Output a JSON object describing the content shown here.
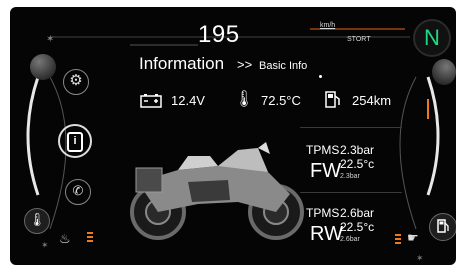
{
  "speed": {
    "value": "195",
    "unit": "km/h",
    "mode": "STORT"
  },
  "gear": "N",
  "header": {
    "title": "Information",
    "breadcrumb": "Basic Info"
  },
  "stats": {
    "battery": "12.4V",
    "coolant": "72.5°C",
    "range": "254km"
  },
  "tpms": {
    "front": {
      "label": "TPMS",
      "pressure": "2.3bar",
      "position": "FW",
      "temperature": "22.5°c",
      "reference": "2.3bar"
    },
    "rear": {
      "label": "TPMS",
      "pressure": "2.6bar",
      "position": "RW",
      "temperature": "22.5°c",
      "reference": "2.6bar"
    }
  },
  "menu": [
    "settings",
    "information",
    "phone"
  ],
  "colors": {
    "gear": "#1fd882",
    "accent": "#f07a1b",
    "background": "#050506"
  }
}
